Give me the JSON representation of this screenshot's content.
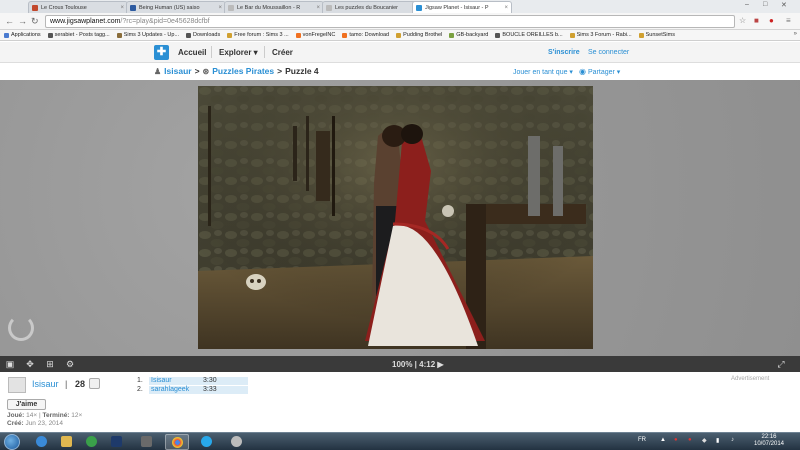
{
  "browser": {
    "tabs": [
      {
        "title": "Le Crous Toulouse",
        "color": "#c2482c"
      },
      {
        "title": "Being Human (US) saiso",
        "color": "#2c5aa0"
      },
      {
        "title": "Le Bar du Moussaillon - R",
        "color": "#e8e8e8"
      },
      {
        "title": "Les puzzles du Boucanier",
        "color": "#e8e8e8"
      },
      {
        "title": "Jigsaw Planet - Isisaur - P",
        "color": "#2a8fd4",
        "active": true
      }
    ],
    "address": {
      "host": "www.jigsawplanet.com",
      "path": "/?rc=play&pid=0e45628dcfbf"
    },
    "bookmarks": [
      {
        "label": "Applications",
        "color": "#4a7bd0"
      },
      {
        "label": "serabiet - Posts tagg...",
        "color": "#555555"
      },
      {
        "label": "Sims 3 Updates - Up...",
        "color": "#8a6d3b"
      },
      {
        "label": "Downloads",
        "color": "#555555"
      },
      {
        "label": "Free forum : Sims 3 ...",
        "color": "#d0a030"
      },
      {
        "label": "vonFregeINC",
        "color": "#f07020"
      },
      {
        "label": "tamo: Download",
        "color": "#f07020"
      },
      {
        "label": "Pudding Brothel",
        "color": "#d0a030"
      },
      {
        "label": "GB-backyard",
        "color": "#7aa040"
      },
      {
        "label": "BOUCLE OREILLES b...",
        "color": "#555555"
      },
      {
        "label": "Sims 3 Forum - Rabi...",
        "color": "#d0a030"
      },
      {
        "label": "SunsetSims",
        "color": "#d0a030"
      }
    ]
  },
  "site": {
    "nav": {
      "home": "Accueil",
      "explore": "Explorer ▾",
      "create": "Créer"
    },
    "signup": "S'inscrire",
    "login": "Se connecter",
    "breadcrumb": {
      "user": "Isisaur",
      "sep1": ">",
      "collection": "Puzzles Pirates",
      "sep2": ">",
      "current": "Puzzle 4"
    },
    "play_as": "Jouer en tant que ▾",
    "share": "Partager ▾"
  },
  "controls": {
    "status": "100% | 4:12 ▶"
  },
  "info": {
    "author": "Isisaur",
    "pipe": "|",
    "count": "28",
    "like": "J'aime",
    "played_label": "Joué:",
    "played": "14×",
    "finished_label": "Terminé:",
    "finished": "12×",
    "created_label": "Créé:",
    "created": "Jun 23, 2014",
    "advert": "Advertisement",
    "scores": [
      {
        "rank": "1.",
        "name": "Isisaur",
        "time": "3:30"
      },
      {
        "rank": "2.",
        "name": "sarahlageek",
        "time": "3:33"
      }
    ]
  },
  "taskbar": {
    "lang": "FR",
    "time": "22:16",
    "date": "10/07/2014"
  }
}
